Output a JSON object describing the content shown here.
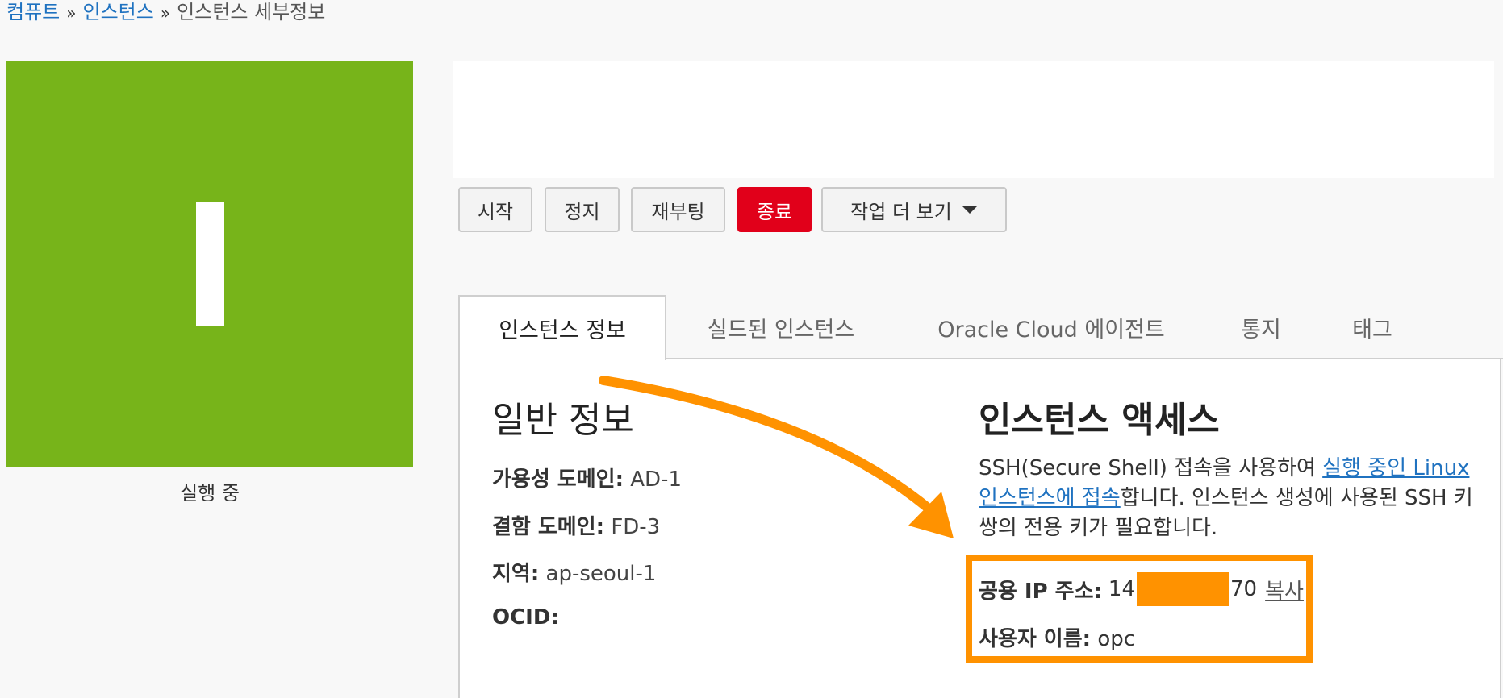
{
  "breadcrumb": {
    "items": [
      "컴퓨트",
      "인스턴스"
    ],
    "separator": "»",
    "current": "인스턴스 세부정보"
  },
  "status": {
    "letter": "I",
    "label": "실행 중",
    "color": "#77b41a"
  },
  "actions": {
    "start": "시작",
    "stop": "정지",
    "reboot": "재부팅",
    "terminate": "종료",
    "more": "작업 더 보기"
  },
  "tabs": [
    "인스턴스 정보",
    "실드된 인스턴스",
    "Oracle Cloud 에이전트",
    "통지",
    "태그"
  ],
  "general": {
    "title": "일반 정보",
    "availability_domain_label": "가용성 도메인:",
    "availability_domain": "AD-1",
    "fault_domain_label": "결함 도메인:",
    "fault_domain": "FD-3",
    "region_label": "지역:",
    "region": "ap-seoul-1",
    "ocid_label": "OCID:"
  },
  "access": {
    "title": "인스턴스 액세스",
    "desc_before": "SSH(Secure Shell) 접속을 사용하여 ",
    "desc_link": "실행 중인 Linux 인스턴스에 접속",
    "desc_after": "합니다. 인스턴스 생성에 사용된 SSH 키 쌍의 전용 키가 필요합니다.",
    "public_ip_label": "공용 IP 주소:",
    "public_ip_prefix": "14",
    "public_ip_suffix": "70",
    "copy_label": "복사",
    "username_label": "사용자 이름:",
    "username": "opc"
  },
  "colors": {
    "accent_link": "#1f72c0",
    "danger": "#e1001a",
    "highlight": "#ff9200"
  }
}
